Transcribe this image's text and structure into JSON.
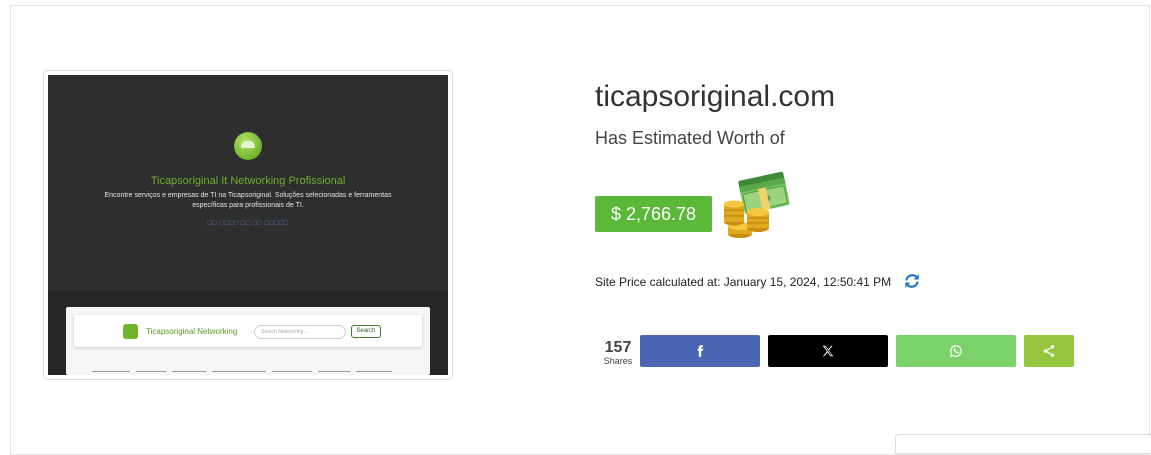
{
  "thumbnail": {
    "hero_title": "Ticapsoriginal It Networking Profissional",
    "hero_description": "Encontre serviços e empresas de TI na Ticapsoriginal. Soluções selecionadas e ferramentas específicas para profissionais de TI.",
    "hero_links": "□□ □□□□ □□ □□ □□□□□",
    "nav_title": "Ticapsoriginal Networking",
    "search_placeholder": "Search Networking ...",
    "search_button": "Search"
  },
  "site": {
    "domain": "ticapsoriginal.com",
    "subtitle": "Has Estimated Worth of",
    "price": "$ 2,766.78",
    "calculated_at": "Site Price calculated at: January 15, 2024, 12:50:41 PM"
  },
  "share": {
    "count": "157",
    "label": "Shares"
  },
  "colors": {
    "price_green": "#5cb838",
    "facebook": "#4a66b3",
    "x": "#000000",
    "whatsapp": "#7cd26a",
    "share": "#95c63d",
    "refresh_blue": "#2a78c8"
  },
  "icons": [
    "money-stack-icon",
    "refresh-icon",
    "facebook-icon",
    "x-icon",
    "whatsapp-icon",
    "share-icon"
  ]
}
